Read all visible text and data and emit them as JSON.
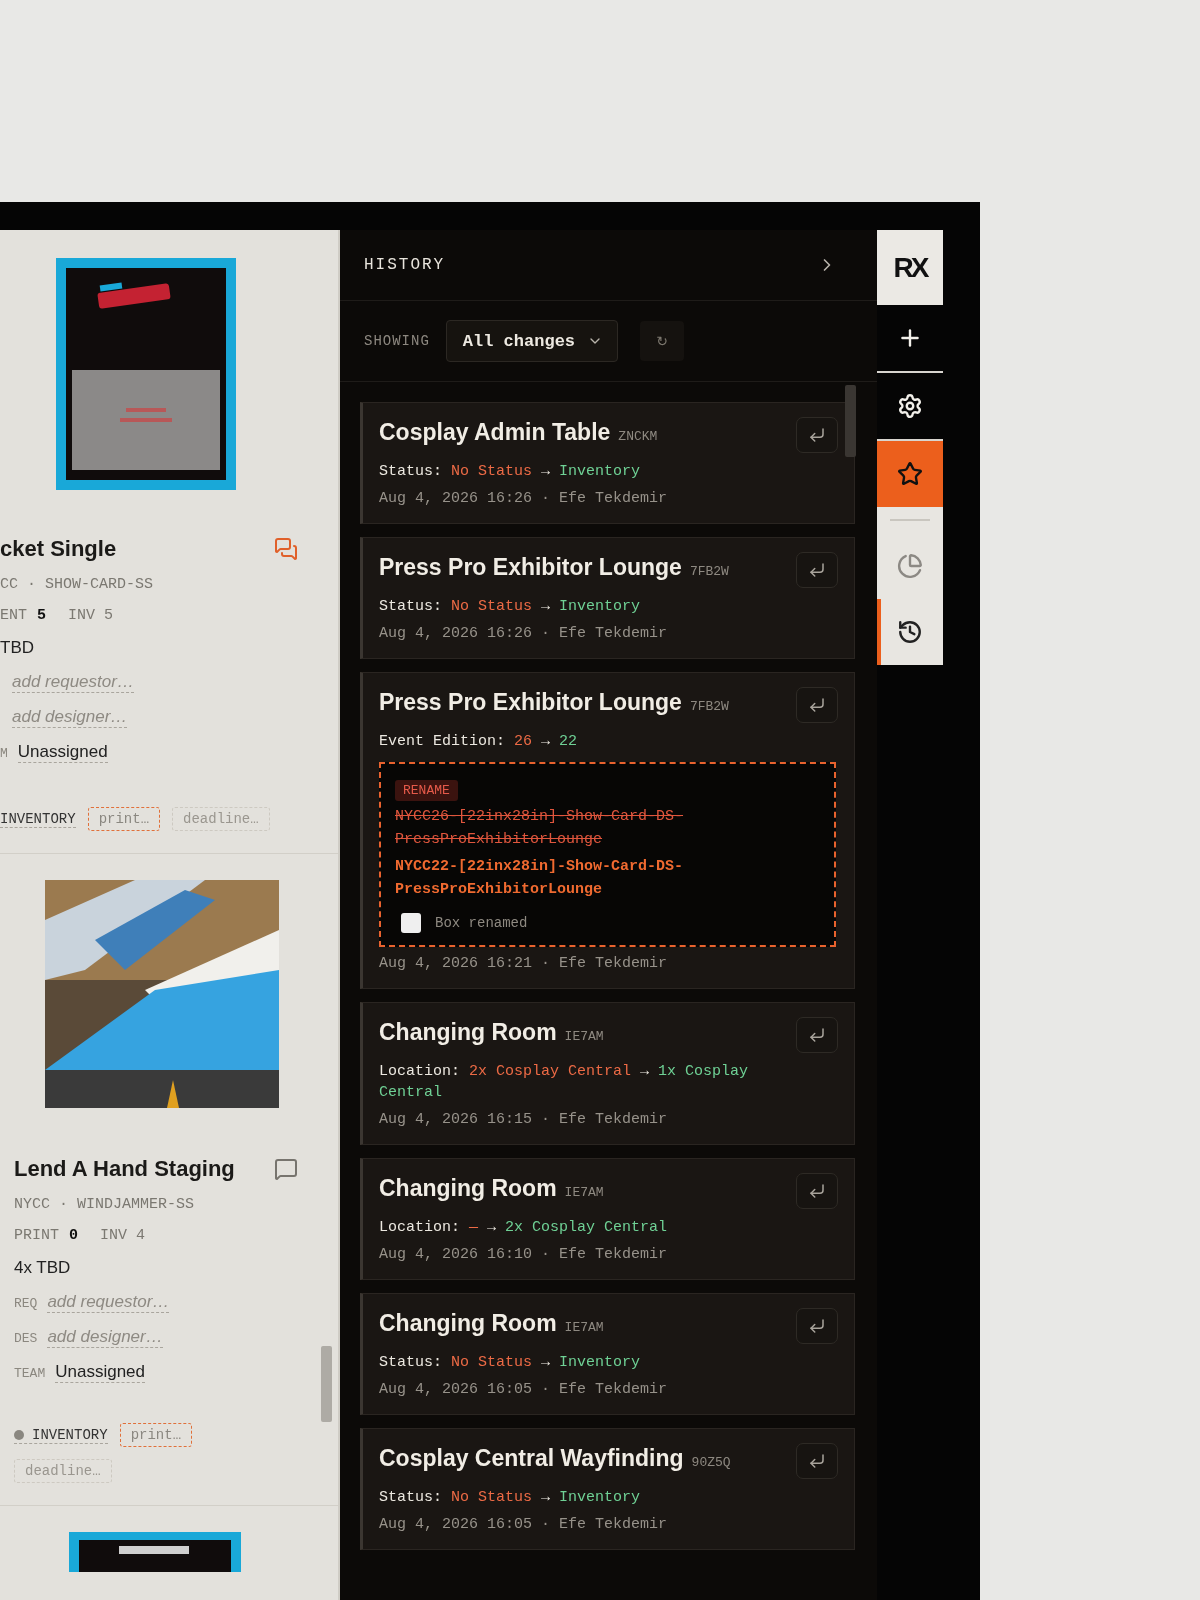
{
  "left_panel": {
    "cards": [
      {
        "title": "cket Single",
        "has_comments": true,
        "code": "CC · SHOW-CARD-SS",
        "print_label": "ENT",
        "print_value": "5",
        "inv": "INV 5",
        "qty": "TBD",
        "fields": [
          {
            "placeholder": "add requestor…"
          },
          {
            "placeholder": "add designer…"
          },
          {
            "label": "M",
            "value": "Unassigned"
          }
        ],
        "status": {
          "label": "INVENTORY",
          "dot": false
        },
        "tags": [
          {
            "text": "print…",
            "kind": "print"
          },
          {
            "text": "deadline…",
            "kind": "deadline"
          }
        ]
      },
      {
        "title": "Lend A Hand Staging",
        "has_comments": false,
        "code": "NYCC · WINDJAMMER-SS",
        "print_label": "PRINT",
        "print_value": "0",
        "inv": "INV 4",
        "qty": "4x TBD",
        "fields": [
          {
            "label": "REQ",
            "placeholder": "add requestor…"
          },
          {
            "label": "DES",
            "placeholder": "add designer…"
          },
          {
            "label": "TEAM",
            "value": "Unassigned"
          }
        ],
        "status": {
          "label": "INVENTORY",
          "dot": true
        },
        "tags": [
          {
            "text": "print…",
            "kind": "print"
          },
          {
            "text": "deadline…",
            "kind": "deadline"
          }
        ]
      }
    ]
  },
  "history": {
    "title": "HISTORY",
    "filter_label": "SHOWING",
    "filter_value": "All changes",
    "refresh": "↻",
    "entries": [
      {
        "title": "Cosplay Admin Table",
        "code": "ZNCKM",
        "change": {
          "field": "Status:",
          "from": "No Status",
          "arrow": "→",
          "to": "Inventory"
        },
        "meta": "Aug 4, 2026 16:26 · Efe Tekdemir"
      },
      {
        "title": "Press Pro Exhibitor Lounge",
        "code": "7FB2W",
        "change": {
          "field": "Status:",
          "from": "No Status",
          "arrow": "→",
          "to": "Inventory"
        },
        "meta": "Aug 4, 2026 16:26 · Efe Tekdemir"
      },
      {
        "title": "Press Pro Exhibitor Lounge",
        "code": "7FB2W",
        "change": {
          "field": "Event Edition:",
          "from": "26",
          "arrow": "→",
          "to": "22"
        },
        "rename": {
          "label": "RENAME",
          "old": "NYCC26-[22inx28in]-Show-Card-DS-PressProExhibitorLounge",
          "new": "NYCC22-[22inx28in]-Show-Card-DS-PressProExhibitorLounge",
          "checkbox": "Box renamed",
          "checked": false
        },
        "meta": "Aug 4, 2026 16:21 · Efe Tekdemir"
      },
      {
        "title": "Changing Room",
        "code": "IE7AM",
        "change": {
          "field": "Location:",
          "from": "2x Cosplay Central",
          "arrow": "→",
          "to": "1x Cosplay Central"
        },
        "meta": "Aug 4, 2026 16:15 · Efe Tekdemir"
      },
      {
        "title": "Changing Room",
        "code": "IE7AM",
        "change": {
          "field": "Location:",
          "from": "—",
          "arrow": "→",
          "to": "2x Cosplay Central"
        },
        "meta": "Aug 4, 2026 16:10 · Efe Tekdemir"
      },
      {
        "title": "Changing Room",
        "code": "IE7AM",
        "change": {
          "field": "Status:",
          "from": "No Status",
          "arrow": "→",
          "to": "Inventory"
        },
        "meta": "Aug 4, 2026 16:05 · Efe Tekdemir"
      },
      {
        "title": "Cosplay Central Wayfinding",
        "code": "90Z5Q",
        "change": {
          "field": "Status:",
          "from": "No Status",
          "arrow": "→",
          "to": "Inventory"
        },
        "meta": "Aug 4, 2026 16:05 · Efe Tekdemir"
      }
    ]
  },
  "rail": {
    "logo": "RX",
    "items": [
      {
        "highlighted": false,
        "selected": false
      },
      {
        "highlighted": false,
        "selected": false
      },
      {
        "highlighted": true,
        "selected": false
      },
      {
        "highlighted": false,
        "selected": false
      },
      {
        "highlighted": false,
        "selected": true
      }
    ]
  }
}
